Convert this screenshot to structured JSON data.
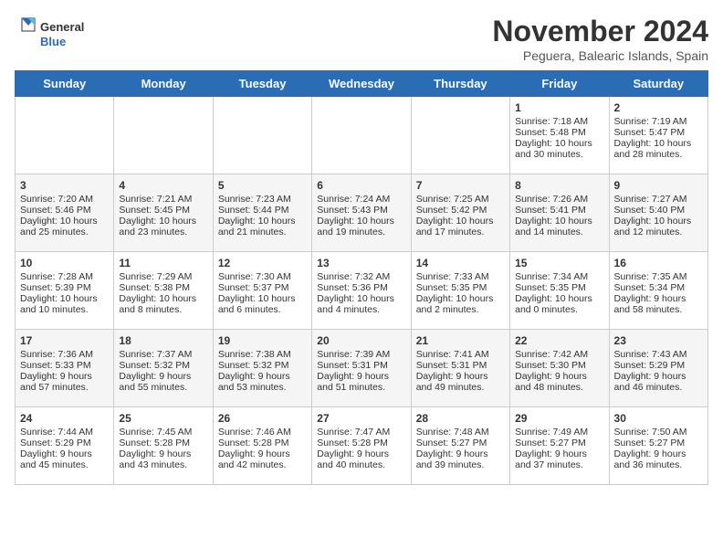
{
  "logo": {
    "line1": "General",
    "line2": "Blue"
  },
  "title": "November 2024",
  "subtitle": "Peguera, Balearic Islands, Spain",
  "days_of_week": [
    "Sunday",
    "Monday",
    "Tuesday",
    "Wednesday",
    "Thursday",
    "Friday",
    "Saturday"
  ],
  "weeks": [
    [
      {
        "day": "",
        "info": ""
      },
      {
        "day": "",
        "info": ""
      },
      {
        "day": "",
        "info": ""
      },
      {
        "day": "",
        "info": ""
      },
      {
        "day": "",
        "info": ""
      },
      {
        "day": "1",
        "info": "Sunrise: 7:18 AM\nSunset: 5:48 PM\nDaylight: 10 hours and 30 minutes."
      },
      {
        "day": "2",
        "info": "Sunrise: 7:19 AM\nSunset: 5:47 PM\nDaylight: 10 hours and 28 minutes."
      }
    ],
    [
      {
        "day": "3",
        "info": "Sunrise: 7:20 AM\nSunset: 5:46 PM\nDaylight: 10 hours and 25 minutes."
      },
      {
        "day": "4",
        "info": "Sunrise: 7:21 AM\nSunset: 5:45 PM\nDaylight: 10 hours and 23 minutes."
      },
      {
        "day": "5",
        "info": "Sunrise: 7:23 AM\nSunset: 5:44 PM\nDaylight: 10 hours and 21 minutes."
      },
      {
        "day": "6",
        "info": "Sunrise: 7:24 AM\nSunset: 5:43 PM\nDaylight: 10 hours and 19 minutes."
      },
      {
        "day": "7",
        "info": "Sunrise: 7:25 AM\nSunset: 5:42 PM\nDaylight: 10 hours and 17 minutes."
      },
      {
        "day": "8",
        "info": "Sunrise: 7:26 AM\nSunset: 5:41 PM\nDaylight: 10 hours and 14 minutes."
      },
      {
        "day": "9",
        "info": "Sunrise: 7:27 AM\nSunset: 5:40 PM\nDaylight: 10 hours and 12 minutes."
      }
    ],
    [
      {
        "day": "10",
        "info": "Sunrise: 7:28 AM\nSunset: 5:39 PM\nDaylight: 10 hours and 10 minutes."
      },
      {
        "day": "11",
        "info": "Sunrise: 7:29 AM\nSunset: 5:38 PM\nDaylight: 10 hours and 8 minutes."
      },
      {
        "day": "12",
        "info": "Sunrise: 7:30 AM\nSunset: 5:37 PM\nDaylight: 10 hours and 6 minutes."
      },
      {
        "day": "13",
        "info": "Sunrise: 7:32 AM\nSunset: 5:36 PM\nDaylight: 10 hours and 4 minutes."
      },
      {
        "day": "14",
        "info": "Sunrise: 7:33 AM\nSunset: 5:35 PM\nDaylight: 10 hours and 2 minutes."
      },
      {
        "day": "15",
        "info": "Sunrise: 7:34 AM\nSunset: 5:35 PM\nDaylight: 10 hours and 0 minutes."
      },
      {
        "day": "16",
        "info": "Sunrise: 7:35 AM\nSunset: 5:34 PM\nDaylight: 9 hours and 58 minutes."
      }
    ],
    [
      {
        "day": "17",
        "info": "Sunrise: 7:36 AM\nSunset: 5:33 PM\nDaylight: 9 hours and 57 minutes."
      },
      {
        "day": "18",
        "info": "Sunrise: 7:37 AM\nSunset: 5:32 PM\nDaylight: 9 hours and 55 minutes."
      },
      {
        "day": "19",
        "info": "Sunrise: 7:38 AM\nSunset: 5:32 PM\nDaylight: 9 hours and 53 minutes."
      },
      {
        "day": "20",
        "info": "Sunrise: 7:39 AM\nSunset: 5:31 PM\nDaylight: 9 hours and 51 minutes."
      },
      {
        "day": "21",
        "info": "Sunrise: 7:41 AM\nSunset: 5:31 PM\nDaylight: 9 hours and 49 minutes."
      },
      {
        "day": "22",
        "info": "Sunrise: 7:42 AM\nSunset: 5:30 PM\nDaylight: 9 hours and 48 minutes."
      },
      {
        "day": "23",
        "info": "Sunrise: 7:43 AM\nSunset: 5:29 PM\nDaylight: 9 hours and 46 minutes."
      }
    ],
    [
      {
        "day": "24",
        "info": "Sunrise: 7:44 AM\nSunset: 5:29 PM\nDaylight: 9 hours and 45 minutes."
      },
      {
        "day": "25",
        "info": "Sunrise: 7:45 AM\nSunset: 5:28 PM\nDaylight: 9 hours and 43 minutes."
      },
      {
        "day": "26",
        "info": "Sunrise: 7:46 AM\nSunset: 5:28 PM\nDaylight: 9 hours and 42 minutes."
      },
      {
        "day": "27",
        "info": "Sunrise: 7:47 AM\nSunset: 5:28 PM\nDaylight: 9 hours and 40 minutes."
      },
      {
        "day": "28",
        "info": "Sunrise: 7:48 AM\nSunset: 5:27 PM\nDaylight: 9 hours and 39 minutes."
      },
      {
        "day": "29",
        "info": "Sunrise: 7:49 AM\nSunset: 5:27 PM\nDaylight: 9 hours and 37 minutes."
      },
      {
        "day": "30",
        "info": "Sunrise: 7:50 AM\nSunset: 5:27 PM\nDaylight: 9 hours and 36 minutes."
      }
    ]
  ]
}
